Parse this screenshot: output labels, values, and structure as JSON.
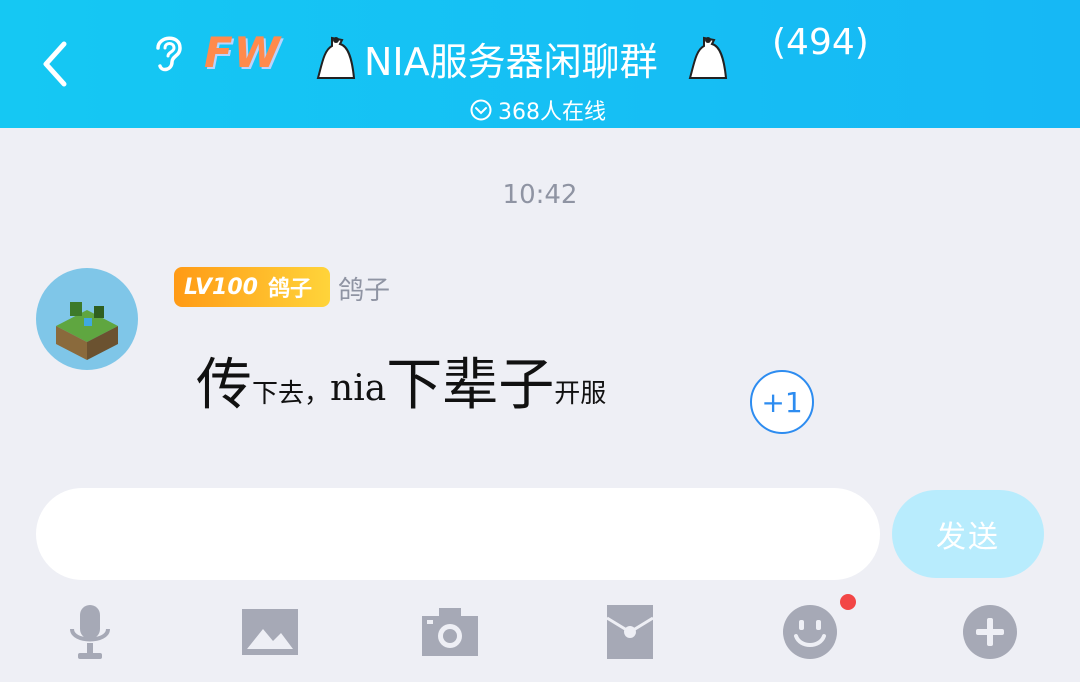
{
  "header": {
    "back_icon": "chevron-left-icon",
    "ear_icon": "ear-icon",
    "logo_text": "FW",
    "ghost_icon": "ghost-icon",
    "title": "NIA服务器闲聊群",
    "member_count": "(494)",
    "online_text": "368人在线",
    "online_icon": "chevron-down-circle-icon"
  },
  "chat": {
    "timestamp": "10:42",
    "message": {
      "level_badge": "LV100",
      "badge_title": "鸽子",
      "nickname": "鸽子",
      "segments": [
        {
          "text": "传",
          "size": "big"
        },
        {
          "text": "下去，",
          "size": "small"
        },
        {
          "text": "nia",
          "size": "mid"
        },
        {
          "text": "下辈子",
          "size": "big"
        },
        {
          "text": "开服",
          "size": "small"
        }
      ],
      "plus_one": "+1"
    }
  },
  "composer": {
    "input_value": "",
    "send_label": "发送"
  },
  "toolbar": {
    "icons": [
      "microphone-icon",
      "image-icon",
      "camera-icon",
      "red-packet-icon",
      "emoji-icon",
      "plus-icon"
    ],
    "notification_color": "#f24646"
  },
  "colors": {
    "header_bg": "#16bff5",
    "accent": "#2d8cf0",
    "send_bg": "#b8ecfd",
    "icon_gray": "#a6a9b6"
  }
}
